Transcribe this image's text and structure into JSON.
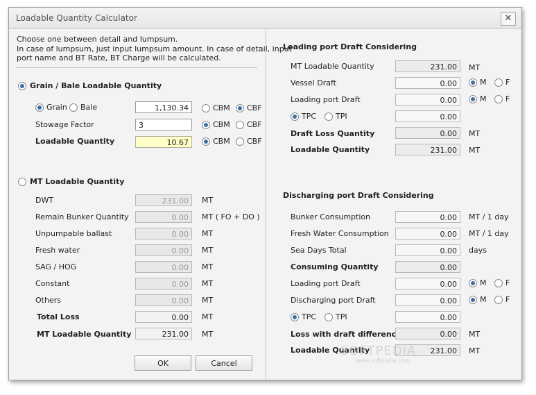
{
  "window": {
    "title": "Loadable Quantity Calculator",
    "close_glyph": "✕"
  },
  "intro": {
    "line1": "Choose one between detail and lumpsum.",
    "line2": "In case of lumpsum, just input lumpsum amount. In case of detail, input",
    "line3": "port name and BT Rate, BT Charge will be calculated."
  },
  "grain": {
    "header": "Grain / Bale Loadable Quantity",
    "grain_label": "Grain",
    "bale_label": "Bale",
    "grain_value": "1,130.34",
    "stowage_label": "Stowage Factor",
    "stowage_value": "3",
    "loadable_label": "Loadable Quantity",
    "loadable_value": "10.67",
    "cbm": "CBM",
    "cbf": "CBF"
  },
  "mt": {
    "header": "MT Loadable Quantity",
    "unit": "MT",
    "rows": [
      {
        "label": "DWT",
        "value": "231.00",
        "unit": "MT"
      },
      {
        "label": "Remain Bunker Quantity",
        "value": "0.00",
        "unit": "MT ( FO + DO )"
      },
      {
        "label": "Unpumpable ballast",
        "value": "0.00",
        "unit": "MT"
      },
      {
        "label": "Fresh water",
        "value": "0.00",
        "unit": "MT"
      },
      {
        "label": "SAG / HOG",
        "value": "0.00",
        "unit": "MT"
      },
      {
        "label": "Constant",
        "value": "0.00",
        "unit": "MT"
      },
      {
        "label": "Others",
        "value": "0.00",
        "unit": "MT"
      }
    ],
    "total_loss_label": "Total Loss",
    "total_loss_value": "0.00",
    "mt_loadable_label": "MT Loadable Quantity",
    "mt_loadable_value": "231.00"
  },
  "buttons": {
    "ok": "OK",
    "cancel": "Cancel"
  },
  "loading": {
    "header": "Loading port Draft Considering",
    "mt_loadable_label": "MT Loadable Quantity",
    "mt_loadable_value": "231.00",
    "vessel_draft_label": "Vessel Draft",
    "vessel_draft_value": "0.00",
    "port_draft_label": "Loading port Draft",
    "port_draft_value": "0.00",
    "tpc": "TPC",
    "tpi": "TPI",
    "tpc_value": "0.00",
    "draft_loss_label": "Draft Loss Quantity",
    "draft_loss_value": "0.00",
    "loadable_label": "Loadable Quantity",
    "loadable_value": "231.00",
    "unit": "MT",
    "m": "M",
    "f": "F"
  },
  "discharging": {
    "header": "Discharging port Draft Considering",
    "bunker_label": "Bunker Consumption",
    "bunker_value": "0.00",
    "bunker_unit": "MT / 1 day",
    "fresh_label": "Fresh Water Consumption",
    "fresh_value": "0.00",
    "fresh_unit": "MT / 1 day",
    "sea_days_label": "Sea Days Total",
    "sea_days_value": "0.00",
    "sea_days_unit": "days",
    "consuming_label": "Consuming Quantity",
    "consuming_value": "0.00",
    "loading_draft_label": "Loading port Draft",
    "loading_draft_value": "0.00",
    "discharging_draft_label": "Discharging port Draft",
    "discharging_draft_value": "0.00",
    "tpc": "TPC",
    "tpi": "TPI",
    "tpc_value": "0.00",
    "loss_label": "Loss with draft difference",
    "loss_value": "0.00",
    "loadable_label": "Loadable Quantity",
    "loadable_value": "231.00",
    "unit": "MT",
    "m": "M",
    "f": "F"
  },
  "watermark": {
    "brand": "SOFTPEDIA",
    "url": "www.softpedia.com"
  }
}
